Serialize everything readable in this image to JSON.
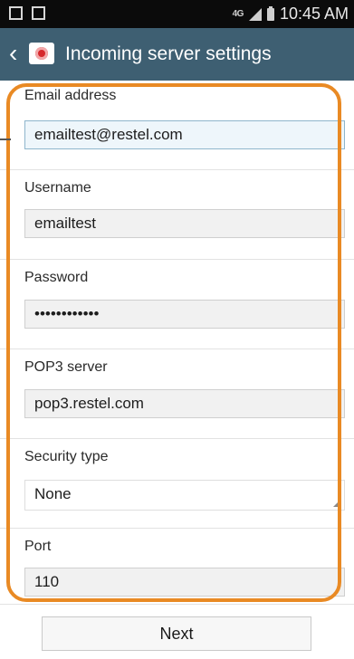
{
  "status_bar": {
    "left_icons": [
      "email-notification-icon",
      "image-notification-icon"
    ],
    "network": "4G",
    "time": "10:45 AM"
  },
  "action_bar": {
    "title": "Incoming server settings",
    "back_icon": "chevron-left-icon",
    "app_icon": "email-app-icon"
  },
  "form": {
    "email": {
      "label": "Email address",
      "value": "emailtest@restel.com"
    },
    "username": {
      "label": "Username",
      "value": "emailtest"
    },
    "password": {
      "label": "Password",
      "value": "••••••••••••"
    },
    "pop3_server": {
      "label": "POP3 server",
      "value": "pop3.restel.com"
    },
    "security_type": {
      "label": "Security type",
      "value": "None"
    },
    "port": {
      "label": "Port",
      "value": "110"
    }
  },
  "buttons": {
    "next": "Next"
  },
  "colors": {
    "action_bar": "#3e5f72",
    "highlight": "#e98a24",
    "status_bar": "#0b0b0b"
  }
}
